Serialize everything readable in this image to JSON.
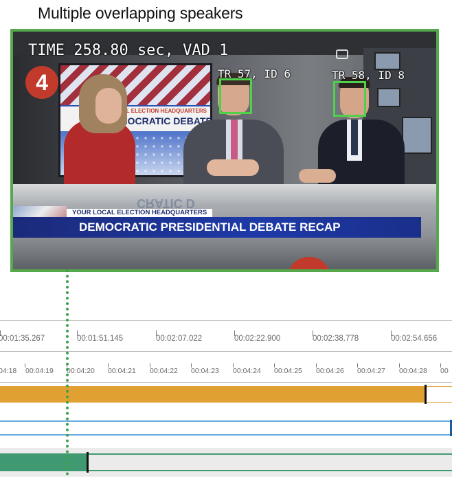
{
  "title": "Multiple overlapping speakers",
  "video": {
    "overlay_time": "TIME 258.80 sec, VAD 1",
    "tracks": [
      {
        "label": "TR 57, ID 6"
      },
      {
        "label": "TR 58, ID 8"
      }
    ],
    "background_logo": "4",
    "screen_small_text": "AL ELECTION HEADQUARTERS",
    "screen_big_text": "MOCRATIC DEBATE",
    "desk_reflection": "CRATIC D",
    "lower_third_small": "YOUR LOCAL ELECTION HEADQUARTERS",
    "lower_third_main": "DEMOCRATIC PRESIDENTIAL DEBATE RECAP",
    "frame_color": "#55a84b",
    "face_box_color": "#4fd14a"
  },
  "timeline": {
    "ruler_coarse": [
      "00:01:35.267",
      "00:01:51.145",
      "00:02:07.022",
      "00:02:22.900",
      "00:02:38.778",
      "00:02:54.656"
    ],
    "ruler_fine": [
      "04:18",
      "00:04:19",
      "00:04:20",
      "00:04:21",
      "00:04:22",
      "00:04:23",
      "00:04:24",
      "00:04:25",
      "00:04:26",
      "00:04:27",
      "00:04:28",
      "00"
    ],
    "track_colors": {
      "orange": "#e0a132",
      "blue": "#6aa9e0",
      "green": "#3f9a72"
    },
    "playhead_color": "#3ea04a"
  }
}
